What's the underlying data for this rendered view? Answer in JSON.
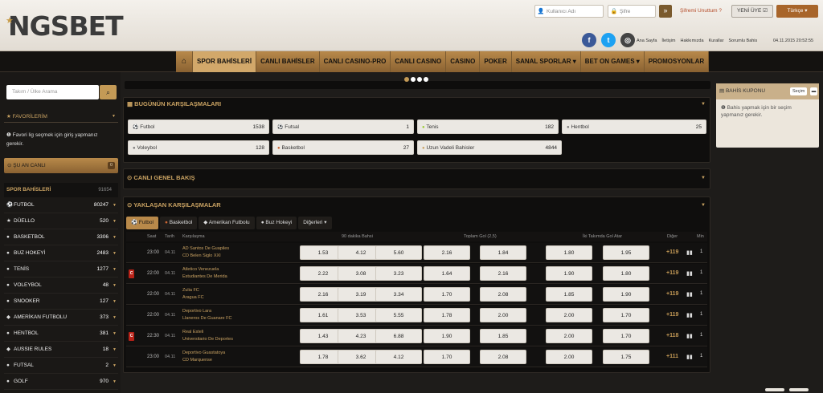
{
  "brand": {
    "name": "NGSBET"
  },
  "login": {
    "username_placeholder": "Kullanıcı Adı",
    "password_placeholder": "Şifre",
    "forgot": "Şifremi Unuttum ?",
    "signup": "YENİ ÜYE",
    "lang": "Türkçe"
  },
  "toplinks": [
    "Ana Sayfa",
    "İletişim",
    "Hakkımızda",
    "Kurallar",
    "Sorumlu Bahis"
  ],
  "datetime": "04.11.2015 20:52:55",
  "menu": [
    "SPOR BAHİSLERİ",
    "CANLI BAHİSLER",
    "CANLI CASINO-PRO",
    "CANLI CASINO",
    "CASINO",
    "POKER",
    "SANAL SPORLAR ▾",
    "BET ON GAMES ▾",
    "PROMOSYONLAR"
  ],
  "sidebar": {
    "search_placeholder": "Takım / Ülke Arama",
    "favorites_title": "★ FAVORİLERİM",
    "favorites_note": "Favori lig seçmek için giriş yapmanız gerekir.",
    "live_label": "⊙ ŞU AN CANLI",
    "live_count": "0",
    "sports_title": "SPOR BAHİSLERİ",
    "sports_count": "91654",
    "sports": [
      {
        "icon": "football-icon",
        "glyph": "⚽",
        "name": "FUTBOL",
        "count": "80247"
      },
      {
        "icon": "star-icon",
        "glyph": "★",
        "name": "DÜELLO",
        "count": "520"
      },
      {
        "icon": "basketball-icon",
        "glyph": "●",
        "name": "BASKETBOL",
        "count": "3306"
      },
      {
        "icon": "hockey-icon",
        "glyph": "●",
        "name": "BUZ HOKEYİ",
        "count": "2483"
      },
      {
        "icon": "tennis-icon",
        "glyph": "●",
        "name": "TENİS",
        "count": "1277"
      },
      {
        "icon": "volleyball-icon",
        "glyph": "●",
        "name": "VOLEYBOL",
        "count": "48"
      },
      {
        "icon": "snooker-icon",
        "glyph": "●",
        "name": "SNOOKER",
        "count": "127"
      },
      {
        "icon": "american-football-icon",
        "glyph": "◆",
        "name": "AMERİKAN FUTBOLU",
        "count": "373"
      },
      {
        "icon": "handball-icon",
        "glyph": "●",
        "name": "HENTBOL",
        "count": "381"
      },
      {
        "icon": "aussie-rules-icon",
        "glyph": "◆",
        "name": "AUSSIE RULES",
        "count": "18"
      },
      {
        "icon": "futsal-icon",
        "glyph": "●",
        "name": "FUTSAL",
        "count": "2"
      },
      {
        "icon": "golf-icon",
        "glyph": "●",
        "name": "GOLF",
        "count": "970"
      }
    ]
  },
  "today": {
    "title": "▦ BUGÜNÜN KARŞILAŞMALARI",
    "cells": [
      {
        "name": "Futbol",
        "count": "1538"
      },
      {
        "name": "Futsal",
        "count": "1"
      },
      {
        "name": "Tenis",
        "count": "182"
      },
      {
        "name": "Hentbol",
        "count": "25"
      },
      {
        "name": "Voleybol",
        "count": "128"
      },
      {
        "name": "Basketbol",
        "count": "27"
      },
      {
        "name": "Uzun Vadeli Bahisler",
        "count": "4844"
      }
    ]
  },
  "live_overview": {
    "title": "⊙ CANLI GENEL BAKIŞ"
  },
  "upcoming": {
    "title": "⊙ YAKLAŞAN KARŞILAŞMALAR",
    "tabs": [
      "Futbol",
      "Basketbol",
      "Amerikan Futbolu",
      "Buz Hokeyi",
      "Diğerleri ▾"
    ],
    "headers": {
      "time": "Saat",
      "date": "Tarih",
      "match": "Karşılaşma",
      "g1": "90 dakika Bahsi",
      "g2": "Toplam Gol (2,5)",
      "g3": "İki Takımda Gol Atar",
      "more": "Diğer",
      "min": "Min"
    },
    "rows": [
      {
        "flag": "",
        "time": "23:00",
        "date": "04.11",
        "home": "AD Santos De Guapiles",
        "away": "CD Belen Siglo XXI",
        "odds": [
          "1.53",
          "4.12",
          "5.60",
          "2.16",
          "1.84",
          "1.80",
          "1.95"
        ],
        "more": "+119",
        "min": "1"
      },
      {
        "flag": "C",
        "time": "22:00",
        "date": "04.11",
        "home": "Atletico Venezuela",
        "away": "Estudiantes De Merida",
        "odds": [
          "2.22",
          "3.08",
          "3.23",
          "1.64",
          "2.16",
          "1.90",
          "1.80"
        ],
        "more": "+119",
        "min": "1"
      },
      {
        "flag": "",
        "time": "22:00",
        "date": "04.11",
        "home": "Zulia FC",
        "away": "Aragua FC",
        "odds": [
          "2.16",
          "3.19",
          "3.34",
          "1.70",
          "2.08",
          "1.85",
          "1.90"
        ],
        "more": "+119",
        "min": "1"
      },
      {
        "flag": "",
        "time": "22:00",
        "date": "04.11",
        "home": "Deportivo Lara",
        "away": "Llaneros De Guanare FC",
        "odds": [
          "1.61",
          "3.53",
          "5.55",
          "1.78",
          "2.00",
          "2.00",
          "1.70"
        ],
        "more": "+119",
        "min": "1"
      },
      {
        "flag": "C",
        "time": "22:30",
        "date": "04.11",
        "home": "Real Esteli",
        "away": "Universitario De Deportes",
        "odds": [
          "1.43",
          "4.23",
          "6.88",
          "1.90",
          "1.85",
          "2.00",
          "1.70"
        ],
        "more": "+118",
        "min": "1"
      },
      {
        "flag": "",
        "time": "23:00",
        "date": "04.11",
        "home": "Deportivo Guastatoya",
        "away": "CD Marquense",
        "odds": [
          "1.78",
          "3.62",
          "4.12",
          "1.70",
          "2.08",
          "2.00",
          "1.75"
        ],
        "more": "+111",
        "min": "1"
      }
    ]
  },
  "coupon": {
    "title": "BAHİS KUPONU",
    "btn": "Seçim",
    "note": "Bahis yapmak için bir seçim yapmanız gerekir."
  },
  "colors": {
    "gold": "#c49a56",
    "gold_dark": "#8a6232",
    "accent_red": "#b82218"
  }
}
